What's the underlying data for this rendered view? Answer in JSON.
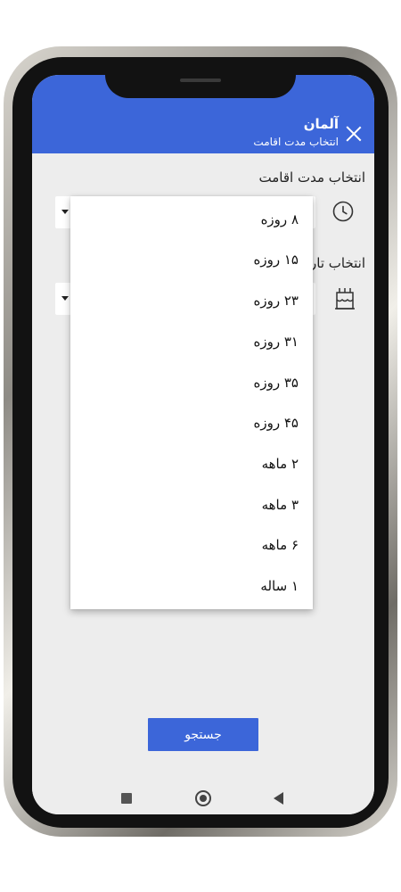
{
  "app_bar": {
    "title": "آلمان",
    "subtitle": "انتخاب مدت اقامت",
    "close_icon": "close-icon"
  },
  "form": {
    "stay_duration_label": "انتخاب مدت اقامت",
    "stay_duration_icon": "clock-icon",
    "date_label": "انتخاب تار",
    "date_icon": "cake-icon"
  },
  "dropdown": {
    "options": [
      "۸ روزه",
      "۱۵ روزه",
      "۲۳ روزه",
      "۳۱ روزه",
      "۳۵ روزه",
      "۴۵ روزه",
      "۲ ماهه",
      "۳ ماهه",
      "۶ ماهه",
      "۱ ساله"
    ]
  },
  "search_button": {
    "label": "جستجو"
  },
  "nav": {
    "icons": [
      "recents-square-icon",
      "home-circle-icon",
      "back-triangle-icon"
    ]
  },
  "colors": {
    "accent": "#3c66d9",
    "background": "#ededed",
    "surface": "#ffffff"
  }
}
